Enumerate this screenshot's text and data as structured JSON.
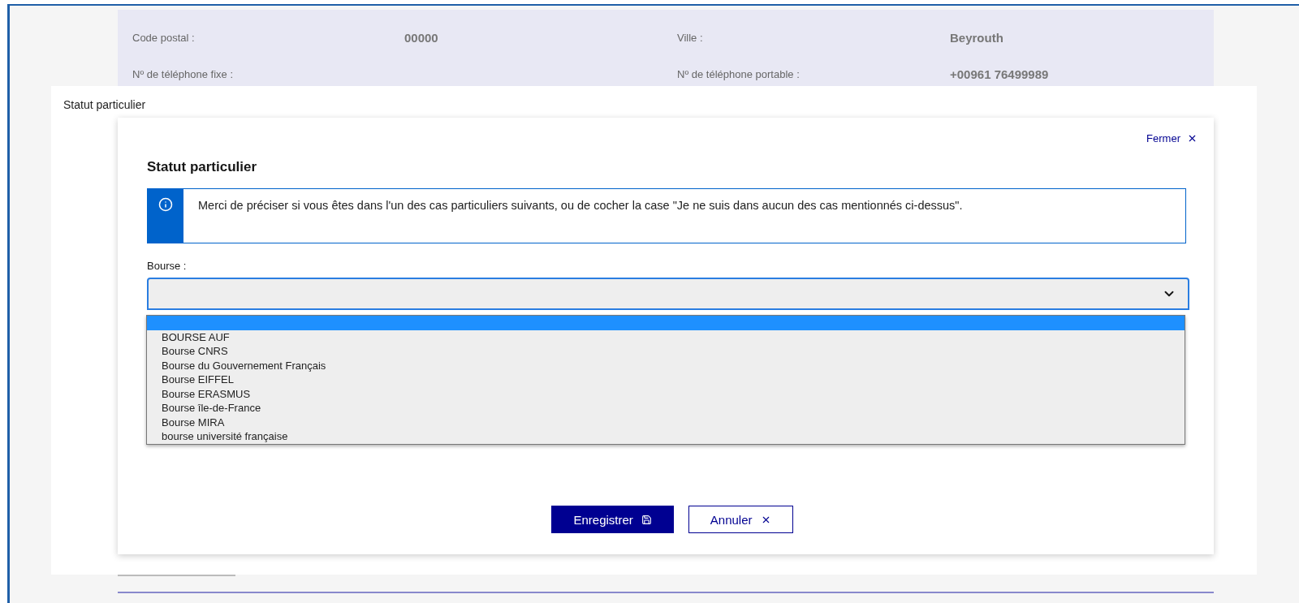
{
  "contact_details": [
    {
      "label": "Code postal :",
      "value": "00000"
    },
    {
      "label": "Ville :",
      "value": "Beyrouth"
    },
    {
      "label": "Nº de téléphone fixe :"
    },
    {
      "label": "Nº de téléphone portable :",
      "value": "+00961 76499989"
    }
  ],
  "section_title": "Statut particulier",
  "dialog": {
    "close_label": "Fermer",
    "title": "Statut particulier",
    "notice": "Merci de préciser si vous êtes dans l'un des cas particuliers suivants, ou de cocher la case \"Je ne suis dans aucun des cas mentionnés ci-dessus\".",
    "field": {
      "label": "Bourse :",
      "expanded": true
    },
    "options": [
      {
        "selected": true
      },
      {
        "label": "BOURSE AUF",
        "selected": false
      },
      {
        "label": "Bourse CNRS",
        "selected": false
      },
      {
        "label": "Bourse du Gouvernement Français",
        "selected": false
      },
      {
        "label": "Bourse EIFFEL",
        "selected": false
      },
      {
        "label": "Bourse ERASMUS",
        "selected": false
      },
      {
        "label": "Bourse île-de-France",
        "selected": false
      },
      {
        "label": "Bourse MIRA",
        "selected": false
      },
      {
        "label": "bourse université française",
        "selected": false
      }
    ],
    "buttons": [
      {
        "label": "Enregistrer",
        "kind": "primary"
      },
      {
        "label": "Annuler",
        "kind": "secondary"
      }
    ]
  }
}
